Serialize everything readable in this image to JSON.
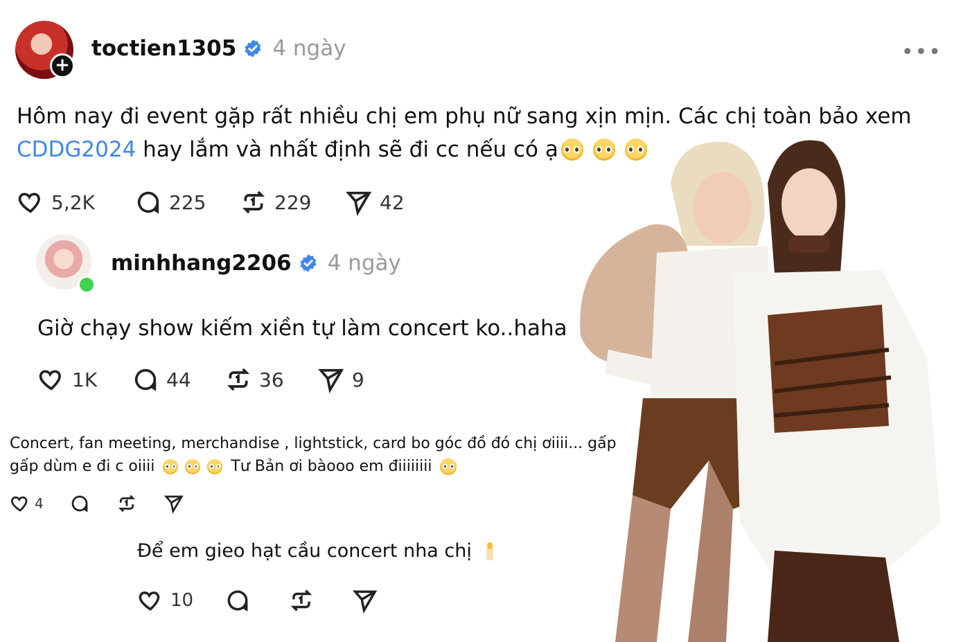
{
  "post": {
    "username": "toctien1305",
    "time": "4 ngày",
    "text_line1": "Hôm nay đi event gặp rất nhiều chị em phụ nữ sang xịn mịn. Các chị toàn bảo xem",
    "hashtag": "CDDG2024",
    "text_line2_after": " hay lắm và nhất định sẽ đi cc nếu có ạ",
    "likes": "5,2K",
    "comments": "225",
    "reposts": "229",
    "shares": "42"
  },
  "reply": {
    "username": "minhhang2206",
    "time": "4 ngày",
    "text": "Giờ chạy show kiếm xiền tự làm concert ko..haha",
    "likes": "1K",
    "comments": "44",
    "reposts": "36",
    "shares": "9"
  },
  "comment": {
    "text_line1": "Concert, fan meeting, merchandise , lightstick, card bo góc đồ đó chị ơiiii... gấp",
    "text_line2_a": "gấp dùm e đi c oiiii",
    "text_line2_b": "Tư Bản ơi bàooo em điiiiiiii",
    "likes": "4"
  },
  "comment2": {
    "text": "Để em gieo hạt cầu concert nha chị",
    "likes": "10"
  },
  "colors": {
    "hashtag": "#3f86e8",
    "verified": "#3f86e8",
    "online": "#3fd150"
  },
  "icons": [
    "plus-icon",
    "verified-icon",
    "more-icon",
    "heart-icon",
    "comment-icon",
    "repost-icon",
    "share-icon",
    "pleading-face-emoji",
    "candle-emoji"
  ]
}
